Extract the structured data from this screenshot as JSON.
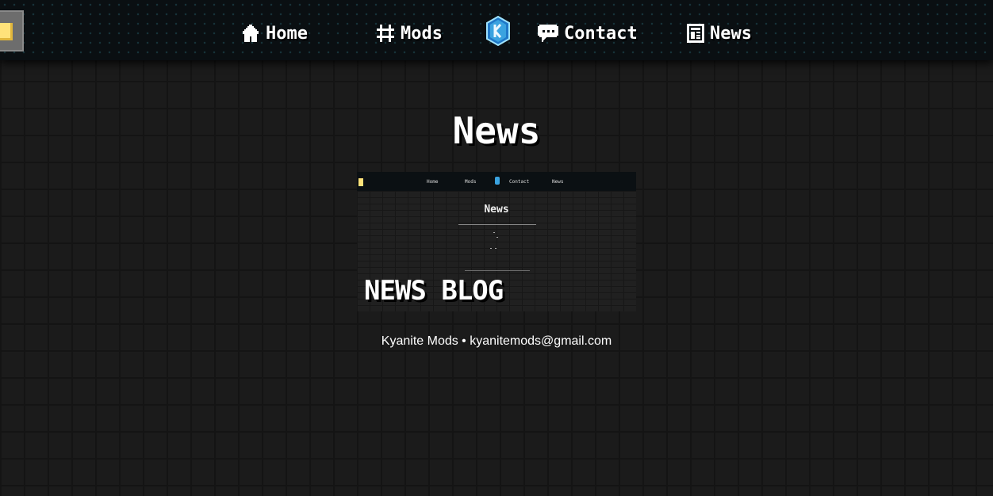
{
  "nav": {
    "items": [
      {
        "label": "Home",
        "icon": "home-icon"
      },
      {
        "label": "Mods",
        "icon": "hash-icon"
      },
      {
        "label": "Contact",
        "icon": "chat-bubble-icon"
      },
      {
        "label": "News",
        "icon": "newspaper-icon"
      }
    ],
    "logo_icon": "kyanite-crystal-icon",
    "menu_icon": "lamp-icon"
  },
  "page": {
    "title": "News"
  },
  "posts": [
    {
      "title": "NEWS BLOG",
      "thumbnail": {
        "nav_items": [
          "Home",
          "Mods",
          "Contact",
          "News"
        ],
        "title": "News"
      }
    }
  ],
  "footer": {
    "text": "Kyanite Mods • kyanitemods@gmail.com"
  },
  "colors": {
    "background": "#1b1b1b",
    "navbar": "#0a0f12",
    "accent": "#3aa3e0",
    "lamp": "#ffe27a"
  }
}
